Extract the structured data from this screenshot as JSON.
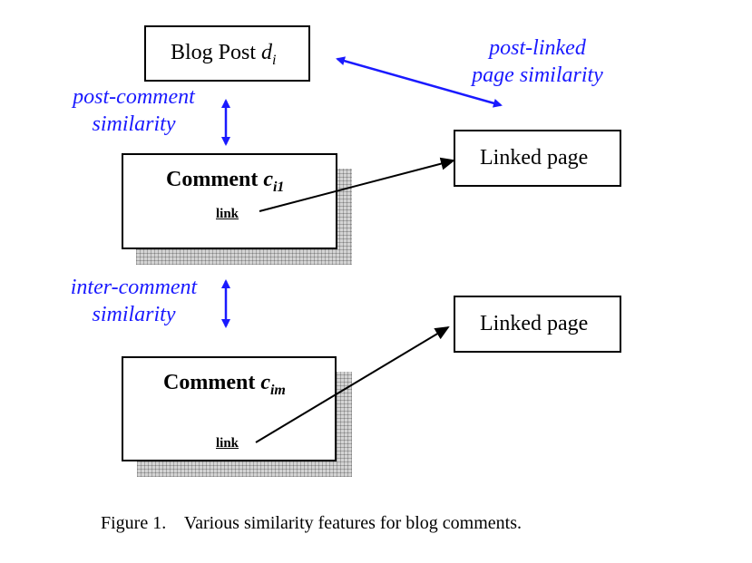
{
  "blog_post": {
    "label": "Blog Post ",
    "var": "d",
    "sub": "i"
  },
  "post_linked_similarity": {
    "line1": "post-linked",
    "line2": "page similarity"
  },
  "post_comment_similarity": {
    "line1": "post-comment",
    "line2": "similarity"
  },
  "inter_comment_similarity": {
    "line1": "inter-comment",
    "line2": "similarity"
  },
  "comment1": {
    "label": "Comment ",
    "var": "c",
    "sub": "i1",
    "link": "link"
  },
  "comment2": {
    "label": "Comment ",
    "var": "c",
    "sub": "im",
    "link": "link"
  },
  "linked_page_1": {
    "label": "Linked page"
  },
  "linked_page_2": {
    "label": "Linked page"
  },
  "caption": "Figure 1.    Various similarity features for blog comments.",
  "colors": {
    "similarity_arrow": "#1a1aff",
    "link_arrow": "#000000",
    "shadow": "#d4d4d4"
  }
}
